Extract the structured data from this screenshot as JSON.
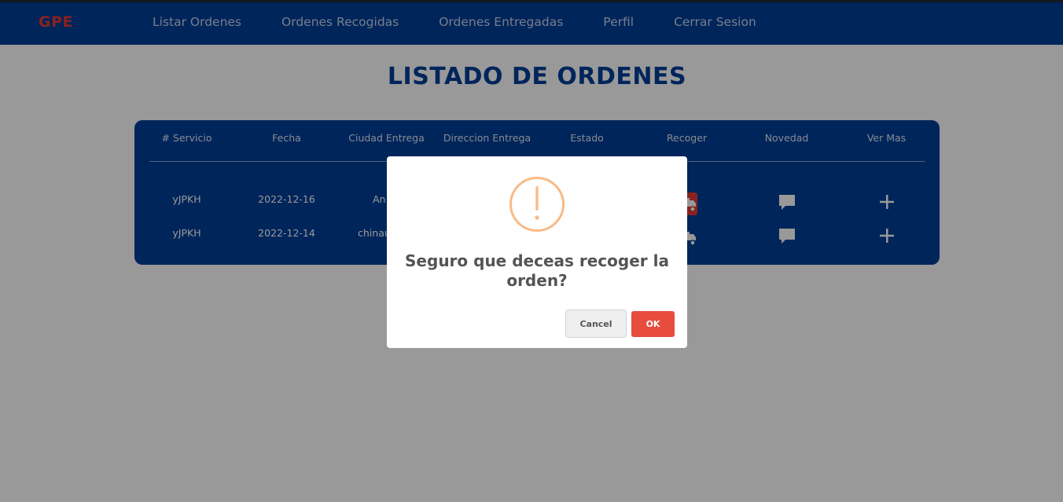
{
  "navbar": {
    "brand": "GPE",
    "links": [
      "Listar Ordenes",
      "Ordenes Recogidas",
      "Ordenes Entregadas",
      "Perfil",
      "Cerrar Sesion"
    ]
  },
  "page": {
    "title": "LISTADO DE ORDENES"
  },
  "table": {
    "headers": [
      "# Servicio",
      "Fecha",
      "Ciudad Entrega",
      "Direccion Entrega",
      "Estado",
      "Recoger",
      "Novedad",
      "Ver Mas"
    ],
    "rows": [
      {
        "servicio": "yJPKH",
        "fecha": "2022-12-16",
        "ciudad": "An"
      },
      {
        "servicio": "yJPKH",
        "fecha": "2022-12-14",
        "ciudad": "chinau"
      }
    ],
    "icons": {
      "recoger": "truck-icon",
      "novedad": "comment-icon",
      "ver_mas": "plus-icon"
    }
  },
  "dialog": {
    "icon": "warning-icon",
    "message": "Seguro que deceas recoger la orden?",
    "cancel_label": "Cancel",
    "ok_label": "OK"
  },
  "colors": {
    "navbar": "#003e98",
    "brand": "#e53935",
    "warning": "#f8bb86",
    "ok_button": "#e74c3c",
    "truck_active": "#e53935"
  }
}
